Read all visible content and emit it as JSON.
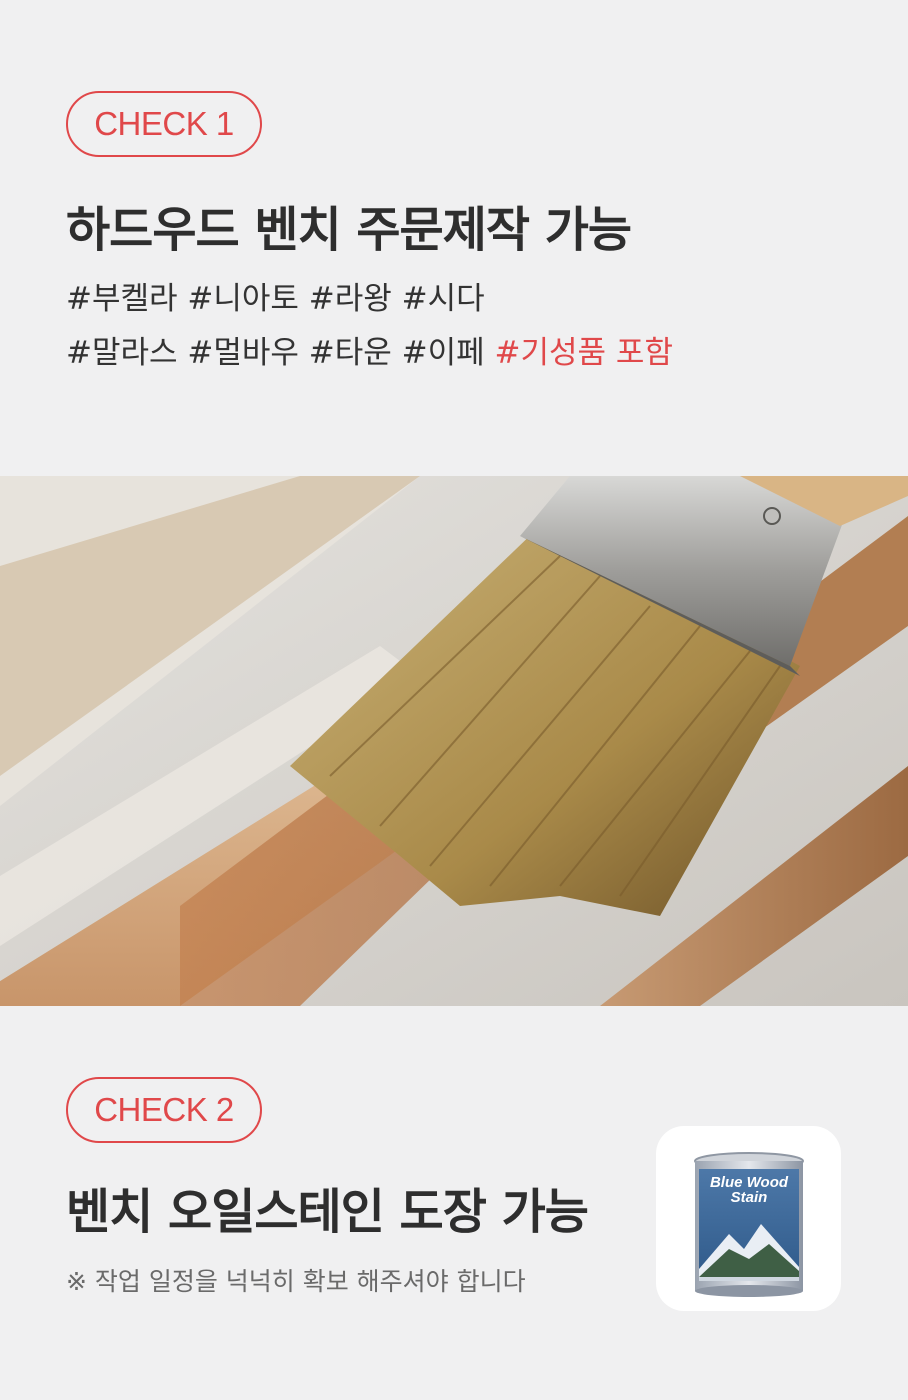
{
  "section1": {
    "badge": "CHECK 1",
    "title": "하드우드 벤치 주문제작 가능",
    "tags_line1": "#부켈라 #니아토 #라왕 #시다",
    "tags_line2": "#말라스 #멀바우 #타운 #이페",
    "tags_highlight": "#기성품 포함"
  },
  "photo": {
    "icon": "paint-brush-on-wood-photo"
  },
  "section2": {
    "badge": "CHECK 2",
    "title": "벤치 오일스테인 도장 가능",
    "note": "※ 작업 일정을 넉넉히 확보 해주셔야 합니다",
    "product": {
      "label_line1": "Blue Wood",
      "label_line2": "Stain",
      "icon": "stain-can-icon"
    }
  },
  "colors": {
    "accent": "#e0484a",
    "background": "#f0f0f1"
  }
}
